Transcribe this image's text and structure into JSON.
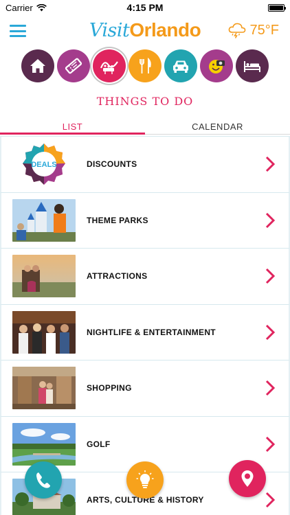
{
  "status": {
    "carrier": "Carrier",
    "time": "4:15 PM",
    "battery_level": 1.0
  },
  "header": {
    "logo_visit": "Visit",
    "logo_orlando": "Orlando",
    "temperature": "75°F"
  },
  "categories": [
    {
      "name": "home",
      "color": "#5a2a4e"
    },
    {
      "name": "tickets",
      "color": "#a43c8c"
    },
    {
      "name": "things-to-do",
      "color": "#e0245e"
    },
    {
      "name": "dining",
      "color": "#f7a21c"
    },
    {
      "name": "transportation",
      "color": "#22a4b0"
    },
    {
      "name": "fun",
      "color": "#a43c8c"
    },
    {
      "name": "hotels",
      "color": "#5a2a4e"
    }
  ],
  "section_title": "THINGS TO DO",
  "tabs": {
    "list": "LIST",
    "calendar": "CALENDAR"
  },
  "items": [
    {
      "label": "DISCOUNTS",
      "thumb": "deals-badge"
    },
    {
      "label": "THEME PARKS",
      "thumb": "photo"
    },
    {
      "label": "ATTRACTIONS",
      "thumb": "photo"
    },
    {
      "label": "NIGHTLIFE & ENTERTAINMENT",
      "thumb": "photo"
    },
    {
      "label": "SHOPPING",
      "thumb": "photo"
    },
    {
      "label": "GOLF",
      "thumb": "photo"
    },
    {
      "label": "ARTS, CULTURE & HISTORY",
      "thumb": "photo"
    }
  ],
  "deals_badge_text": "DEALS",
  "fabs": {
    "call": "phone-icon",
    "tips": "lightbulb-icon",
    "map": "map-pin-icon"
  },
  "colors": {
    "accent_pink": "#e0245e",
    "accent_blue": "#2aa8d8",
    "accent_orange": "#f49a1a"
  }
}
